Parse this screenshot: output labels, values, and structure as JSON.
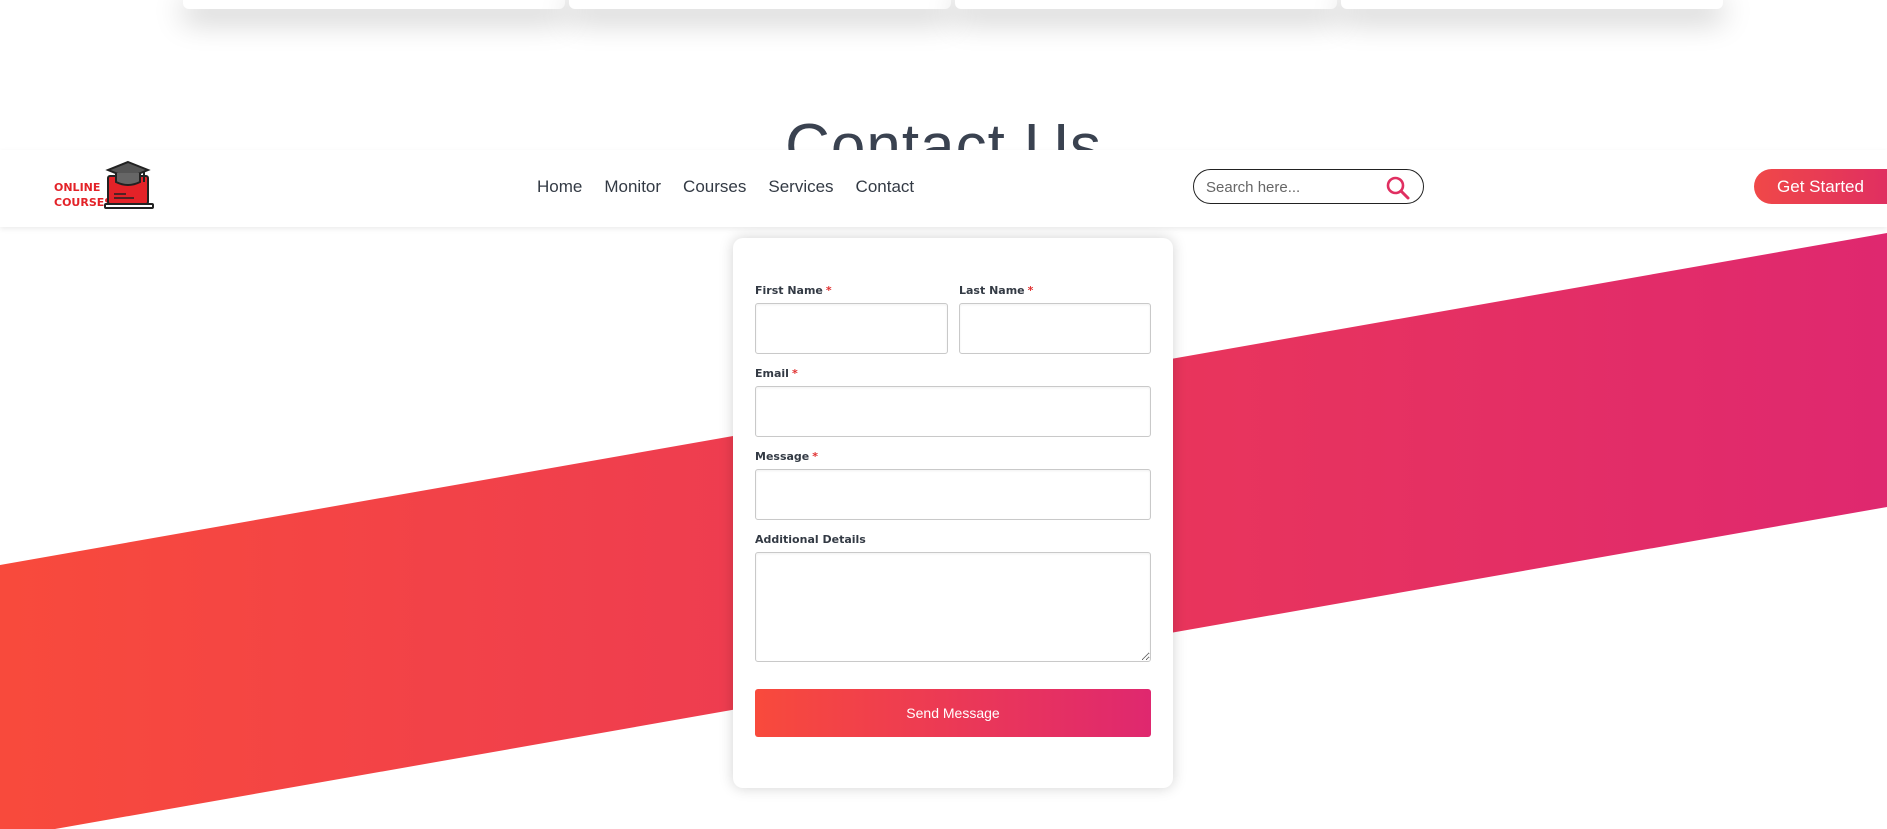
{
  "section": {
    "heading": "Contact Us"
  },
  "logo": {
    "line1": "ONLINE",
    "line2": "COURSES"
  },
  "nav": {
    "items": [
      {
        "label": "Home"
      },
      {
        "label": "Monitor"
      },
      {
        "label": "Courses"
      },
      {
        "label": "Services"
      },
      {
        "label": "Contact"
      }
    ],
    "search": {
      "placeholder": "Search here...",
      "value": ""
    },
    "cta_label": "Get Started"
  },
  "form": {
    "first_name": {
      "label": "First Name",
      "required_mark": "*",
      "value": ""
    },
    "last_name": {
      "label": "Last Name",
      "required_mark": "*",
      "value": ""
    },
    "email": {
      "label": "Email",
      "required_mark": "*",
      "value": ""
    },
    "message": {
      "label": "Message",
      "required_mark": "*",
      "value": ""
    },
    "additional": {
      "label": "Additional Details",
      "value": ""
    },
    "submit_label": "Send Message"
  },
  "colors": {
    "gradient_start": "#f84a3c",
    "gradient_end": "#df286f",
    "required": "#e02f2f",
    "text": "#333a44"
  },
  "icons": [
    "graduation-cap-laptop-logo",
    "search-icon"
  ]
}
